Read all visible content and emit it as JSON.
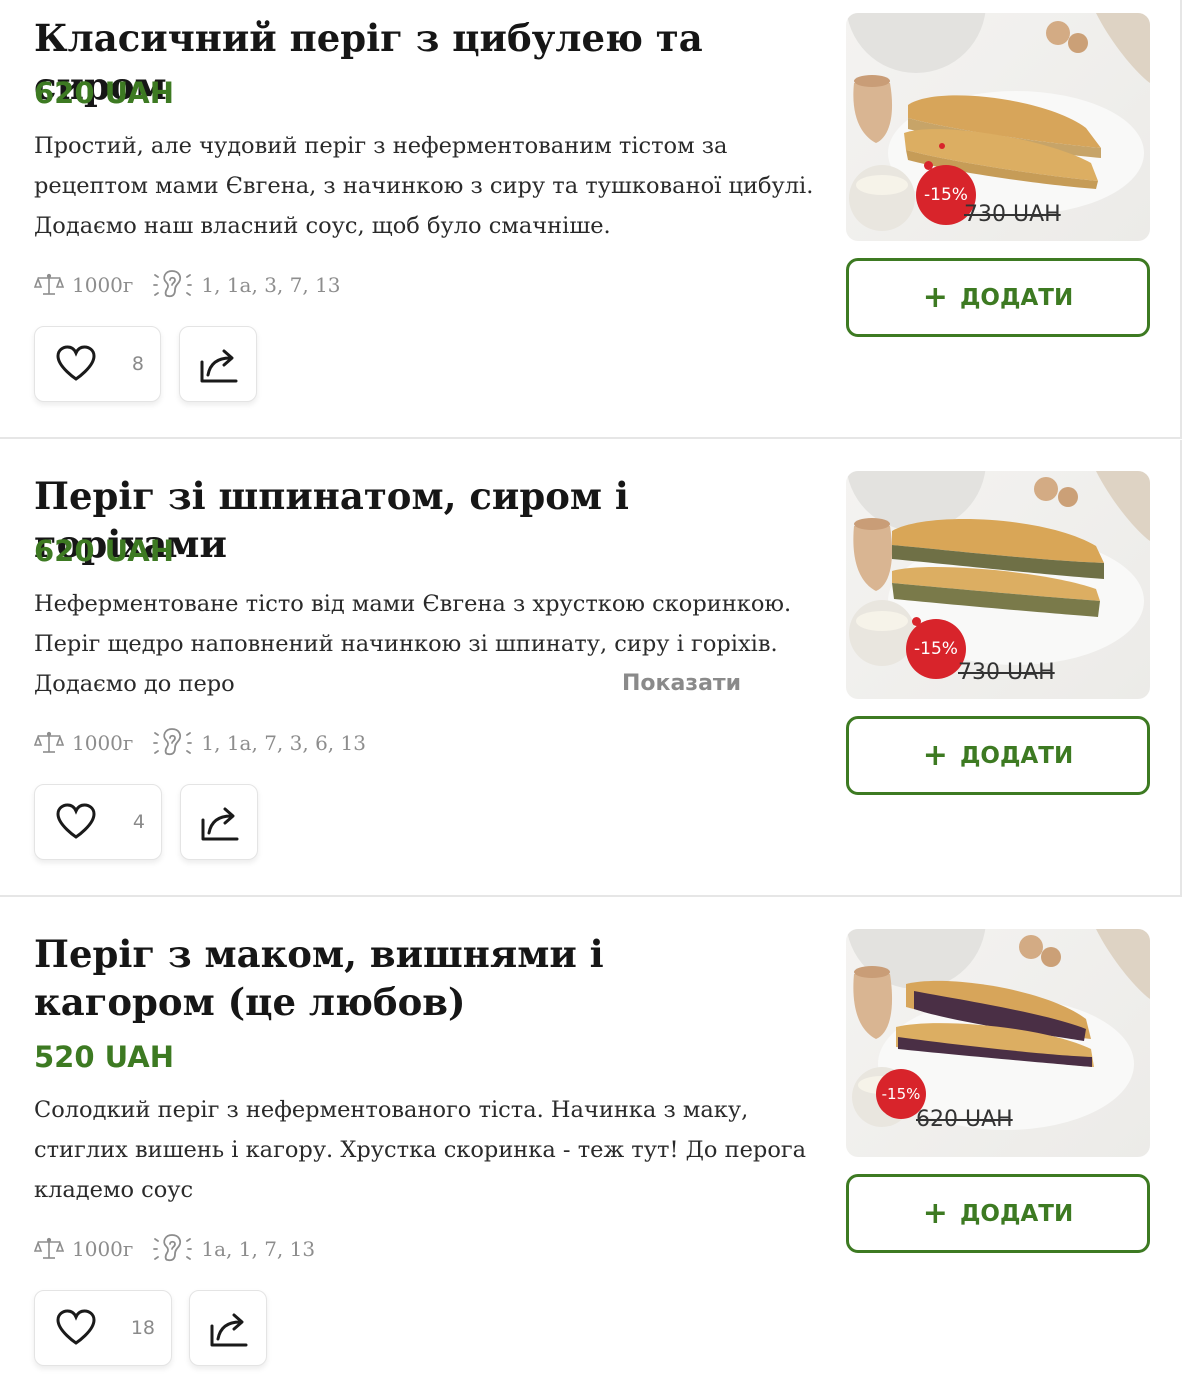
{
  "products": [
    {
      "title": "Класичний періг з цибулею та сиром",
      "price": "620 UAH",
      "description": "Простий, але чудовий періг з неферментованим тістом за рецептом мами Євгена, з начинкою з сиру та тушкованої цибулі. Додаємо наш власний соус, щоб було смачніше.",
      "show_more": "",
      "weight": "1000г",
      "allergens": "1, 1а, 3, 7, 13",
      "likes": "8",
      "discount": "-15%",
      "old_price": "730 UAH",
      "add_label": "ДОДАТИ",
      "filling_color": "#c7a468"
    },
    {
      "title": "Періг зі шпинатом, сиром і горіхами",
      "price": "620 UAH",
      "description": "Неферментоване тісто від мами Євгена з хрусткою скоринкою. Періг щедро наповнений начинкою зі шпинату, сиру і горіхів. Додаємо до перо",
      "show_more": "Показати більше",
      "weight": "1000г",
      "allergens": "1, 1а, 7, 3, 6, 13",
      "likes": "4",
      "discount": "-15%",
      "old_price": "730 UAH",
      "add_label": "ДОДАТИ",
      "filling_color": "#6f7046"
    },
    {
      "title": "Періг з маком, вишнями і кагором (це любов)",
      "price": "520 UAH",
      "description": "Солодкий періг з неферментованого тіста. Начинка з маку, стиглих вишень і кагору. Хрустка скоринка - теж тут! До перога кладемо соус",
      "show_more": "",
      "weight": "1000г",
      "allergens": "1а, 1, 7, 13",
      "likes": "18",
      "discount": "-15%",
      "old_price": "620 UAH",
      "add_label": "ДОДАТИ",
      "filling_color": "#4a2f45"
    }
  ],
  "colors": {
    "accent_green": "#3d7a22",
    "discount_red": "#d8242b",
    "muted_text": "#8d8d8d"
  },
  "icons": [
    "scale-icon",
    "allergen-ear-icon",
    "heart-icon",
    "share-icon",
    "plus-icon"
  ]
}
